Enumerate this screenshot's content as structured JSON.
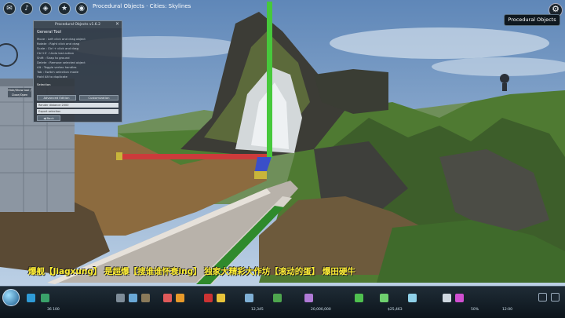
{
  "game": {
    "title_text": "Procedural Objects · Cities: Skylines",
    "top_icons": [
      "speech-bubble-icon",
      "chirper-icon",
      "unlock-icon",
      "achievements-icon",
      "camera-icon"
    ],
    "procedural_button": "Procedural Objects",
    "settings_icon": "gear-icon"
  },
  "panel": {
    "header": "Procedural Objects v1.6.2",
    "close": "×",
    "subtitle": "General Tool",
    "lines": [
      "Move : Left click and drag object",
      "Rotate : Right click and drag",
      "Scale : Ctrl + click and drag",
      "Ctrl+Z : Undo last action",
      "Shift : Snap to ground",
      "Delete : Remove selected object",
      "Alt : Toggle vertex handles",
      "Tab : Switch selection mode",
      "Hold Alt to duplicate"
    ],
    "section": "Selection",
    "buttons": [
      "Advanced Edition",
      "Customization"
    ],
    "input_a": "Render distance 2000",
    "input_b": "Export selection",
    "back": "◀ Back"
  },
  "side_tag": "Hide/Show tool / Close/Open",
  "subtitle_text": "爆舰【Jiagxung】 是超爆【搜谁谁怀衰ing】 独家大精彩大作坊【滚动的蛋】 爆田硬牛",
  "toolbar": {
    "stats": [
      "36 100",
      "12,345",
      "20,000,000",
      "$25,463",
      "50%",
      "12:00"
    ],
    "icons": [
      "zone-icon",
      "road-icon",
      "electricity-icon",
      "water-icon",
      "garbage-icon",
      "health-icon",
      "fire-icon",
      "police-icon",
      "education-icon",
      "transport-icon",
      "park-icon",
      "unique-building-icon",
      "monument-icon",
      "district-icon",
      "bulldozer-icon",
      "info-icon",
      "settings-icon"
    ]
  },
  "colors": {
    "axis_x": "#cc3b3b",
    "axis_y": "#47c83c",
    "axis_z": "#3a4fc9",
    "subtitle": "#ffee33"
  }
}
